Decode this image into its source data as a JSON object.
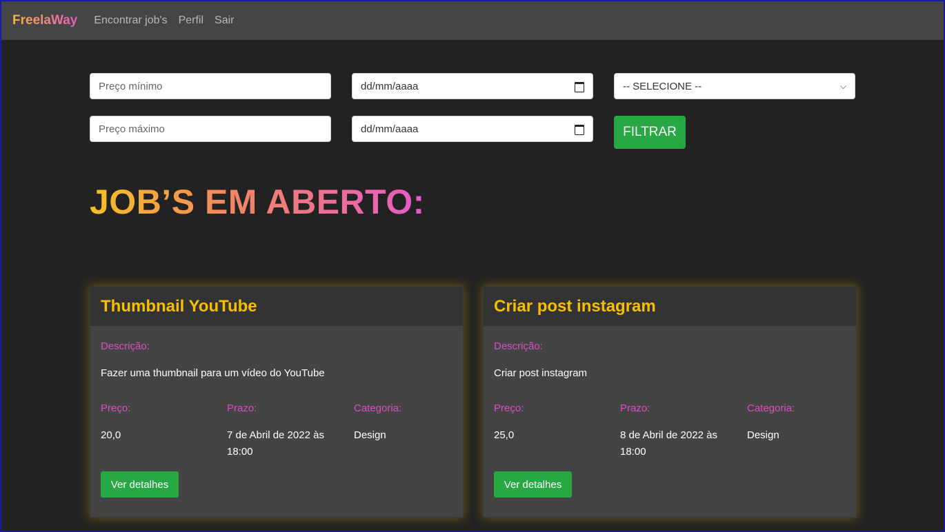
{
  "nav": {
    "brand": "FreelaWay",
    "links": [
      "Encontrar job's",
      "Perfil",
      "Sair"
    ]
  },
  "filters": {
    "price_min_placeholder": "Preço mínimo",
    "price_max_placeholder": "Preço máximo",
    "date_placeholder": "dd/mm/aaaa",
    "category_selected": "-- SELECIONE --",
    "filter_button": "FILTRAR"
  },
  "heading": "JOB’S EM ABERTO:",
  "labels": {
    "descricao": "Descrição:",
    "preco": "Preço:",
    "prazo": "Prazo:",
    "categoria": "Categoria:",
    "details_button": "Ver detalhes"
  },
  "jobs": [
    {
      "title": "Thumbnail YouTube",
      "description": "Fazer uma thumbnail para um vídeo do YouTube",
      "price": "20,0",
      "deadline_line1": "7 de Abril de 2022 às",
      "deadline_line2": "18:00",
      "category": "Design"
    },
    {
      "title": "Criar post instagram",
      "description": "Criar post instagram",
      "price": "25,0",
      "deadline_line1": "8 de Abril de 2022 às",
      "deadline_line2": "18:00",
      "category": "Design"
    }
  ],
  "colors": {
    "accent_green": "#28a745",
    "title_yellow": "#f6c000",
    "label_pink": "#d94fc4",
    "background": "#222222"
  }
}
